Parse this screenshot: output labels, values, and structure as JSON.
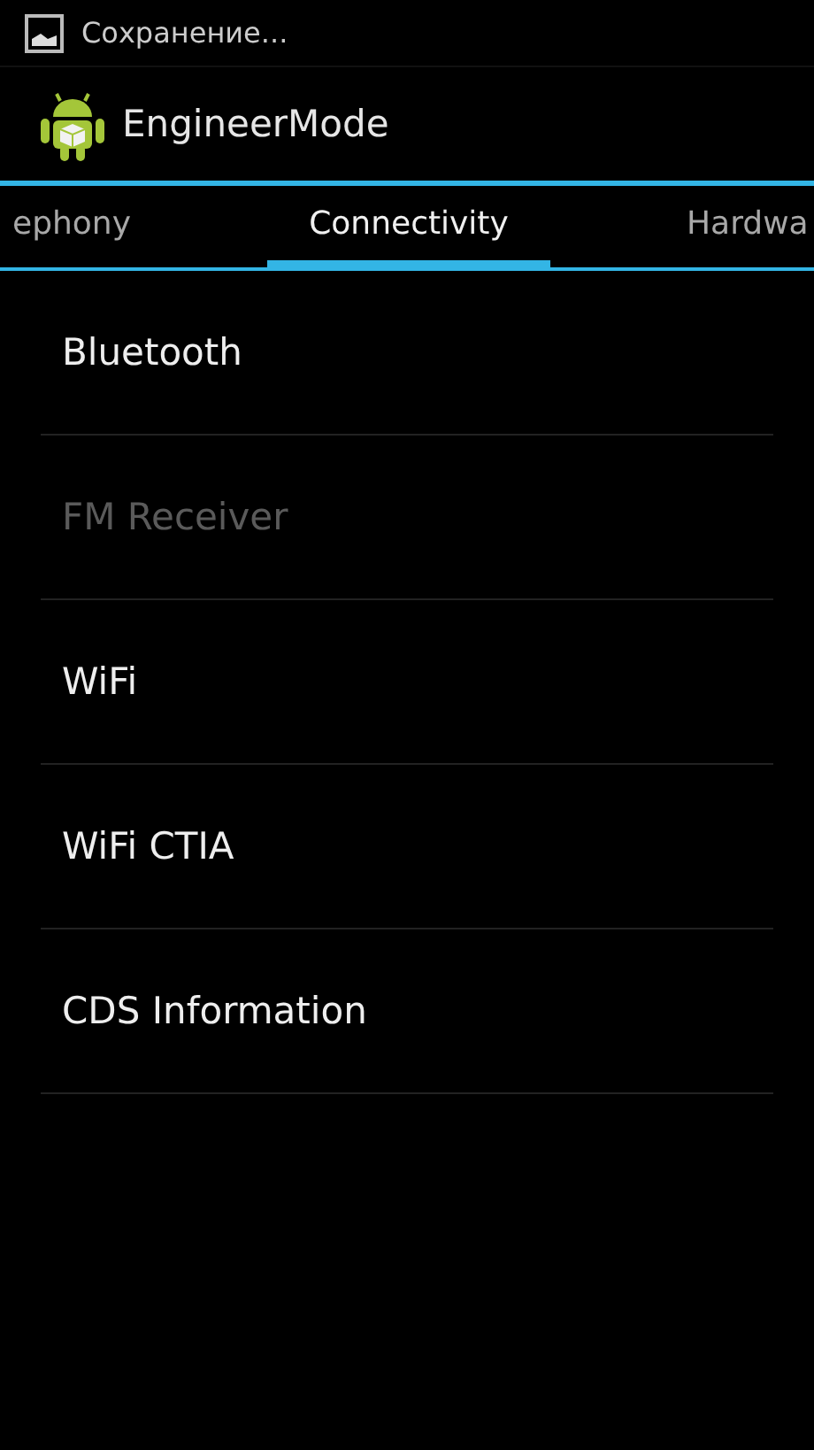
{
  "status_bar": {
    "notification": "Сохранение..."
  },
  "action_bar": {
    "title": "EngineerMode"
  },
  "tabs": [
    {
      "label": "ephony",
      "selected": false
    },
    {
      "label": "Connectivity",
      "selected": true
    },
    {
      "label": "Hardwa",
      "selected": false
    }
  ],
  "items": [
    {
      "label": "Bluetooth",
      "disabled": false
    },
    {
      "label": "FM Receiver",
      "disabled": true
    },
    {
      "label": "WiFi",
      "disabled": false
    },
    {
      "label": "WiFi CTIA",
      "disabled": false
    },
    {
      "label": "CDS Information",
      "disabled": false
    }
  ]
}
